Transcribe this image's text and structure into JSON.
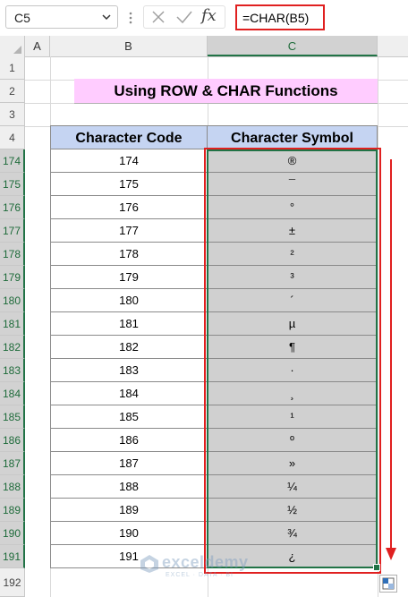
{
  "formula_bar": {
    "name_box": "C5",
    "cancel_icon": "x-icon",
    "enter_icon": "check-icon",
    "fx_label": "fx",
    "formula": "=CHAR(B5)"
  },
  "columns": [
    "A",
    "B",
    "C"
  ],
  "rows_top": [
    "1",
    "2",
    "3",
    "4"
  ],
  "title": "Using ROW & CHAR Functions",
  "headers": {
    "code": "Character Code",
    "symbol": "Character Symbol"
  },
  "data_rows": [
    {
      "row": "174",
      "code": "174",
      "symbol": "®"
    },
    {
      "row": "175",
      "code": "175",
      "symbol": "¯"
    },
    {
      "row": "176",
      "code": "176",
      "symbol": "°"
    },
    {
      "row": "177",
      "code": "177",
      "symbol": "±"
    },
    {
      "row": "178",
      "code": "178",
      "symbol": "²"
    },
    {
      "row": "179",
      "code": "179",
      "symbol": "³"
    },
    {
      "row": "180",
      "code": "180",
      "symbol": "´"
    },
    {
      "row": "181",
      "code": "181",
      "symbol": "µ"
    },
    {
      "row": "182",
      "code": "182",
      "symbol": "¶"
    },
    {
      "row": "183",
      "code": "183",
      "symbol": "·"
    },
    {
      "row": "184",
      "code": "184",
      "symbol": "¸"
    },
    {
      "row": "185",
      "code": "185",
      "symbol": "¹"
    },
    {
      "row": "186",
      "code": "186",
      "symbol": "º"
    },
    {
      "row": "187",
      "code": "187",
      "symbol": "»"
    },
    {
      "row": "188",
      "code": "188",
      "symbol": "¼"
    },
    {
      "row": "189",
      "code": "189",
      "symbol": "½"
    },
    {
      "row": "190",
      "code": "190",
      "symbol": "¾"
    },
    {
      "row": "191",
      "code": "191",
      "symbol": "¿"
    }
  ],
  "row_after": "192",
  "watermark": {
    "name": "exceldemy",
    "tagline": "EXCEL · DATA · BI"
  },
  "colors": {
    "title_fill": "#ffccff",
    "header_fill": "#c5d4f2",
    "selection_fill": "#d0d0d0",
    "excel_green": "#217346",
    "annotation_red": "#e02020"
  }
}
